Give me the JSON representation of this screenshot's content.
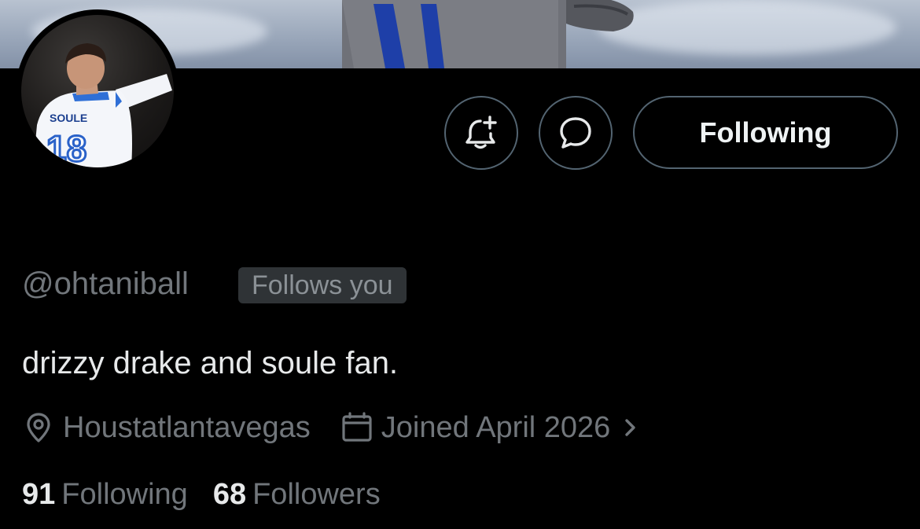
{
  "profile": {
    "handle": "@ohtaniball",
    "follows_you_badge": "Follows you",
    "bio": "drizzy drake and soule fan.",
    "location": "Houstatlantavegas",
    "joined": "Joined April 2026",
    "jersey_name": "SOULE",
    "jersey_number": "18"
  },
  "actions": {
    "notify_icon": "bell-plus-icon",
    "message_icon": "chat-bubble-icon",
    "follow_label": "Following"
  },
  "stats": {
    "following_count": "91",
    "following_label": "Following",
    "followers_count": "68",
    "followers_label": "Followers"
  },
  "colors": {
    "background": "#000000",
    "text_primary": "#e7e9ea",
    "text_secondary": "#71767b",
    "border": "#536471",
    "badge_bg": "#2f3336"
  }
}
